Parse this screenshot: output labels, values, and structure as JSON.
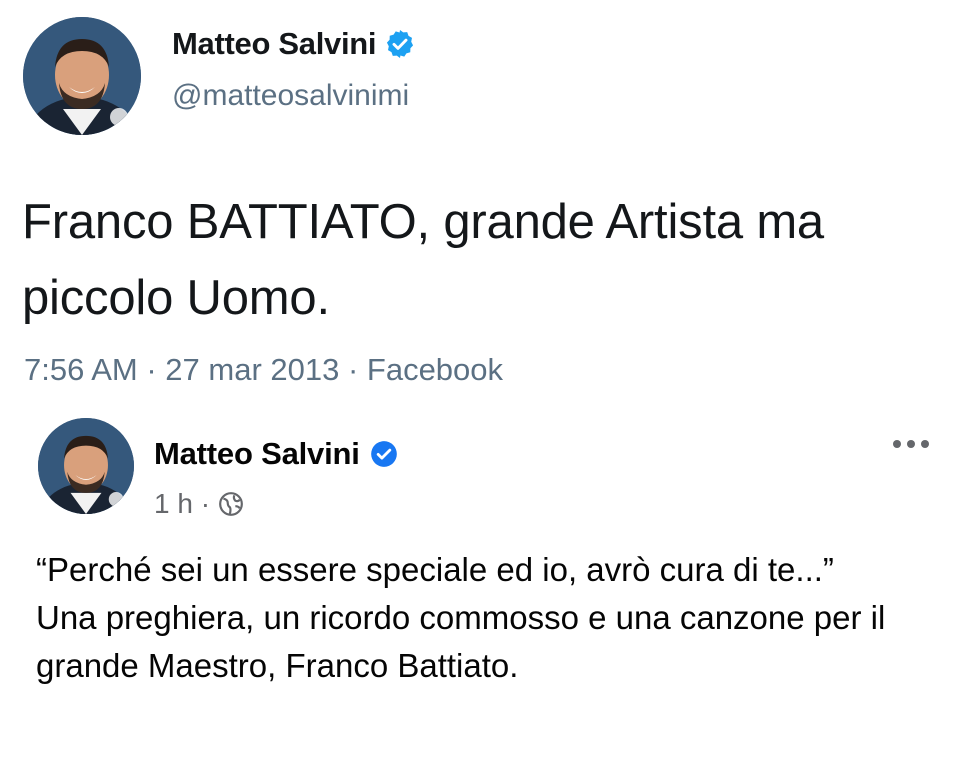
{
  "tweet": {
    "author_name": "Matteo Salvini",
    "handle": "@matteosalvinimi",
    "text_line1": "Franco BATTIATO, grande Artista ma",
    "text_line2": "piccolo Uomo.",
    "meta": "7:56 AM · 27 mar 2013 · Facebook",
    "verified_icon": "verified-badge-icon"
  },
  "facebook_post": {
    "author_name": "Matteo Salvini",
    "time": "1 h ·",
    "audience_icon": "globe-icon",
    "more_icon": "more-options-icon",
    "paragraph1": "“Perché sei un essere speciale ed io, avrò cura di te...”",
    "paragraph2": "Una preghiera, un ricordo commosso e una canzone per il grande Maestro, Franco Battiato."
  },
  "colors": {
    "twitter_verified": "#1da1f2",
    "facebook_verified": "#1877f2",
    "secondary_text": "#5b7083",
    "facebook_secondary": "#65676b"
  }
}
